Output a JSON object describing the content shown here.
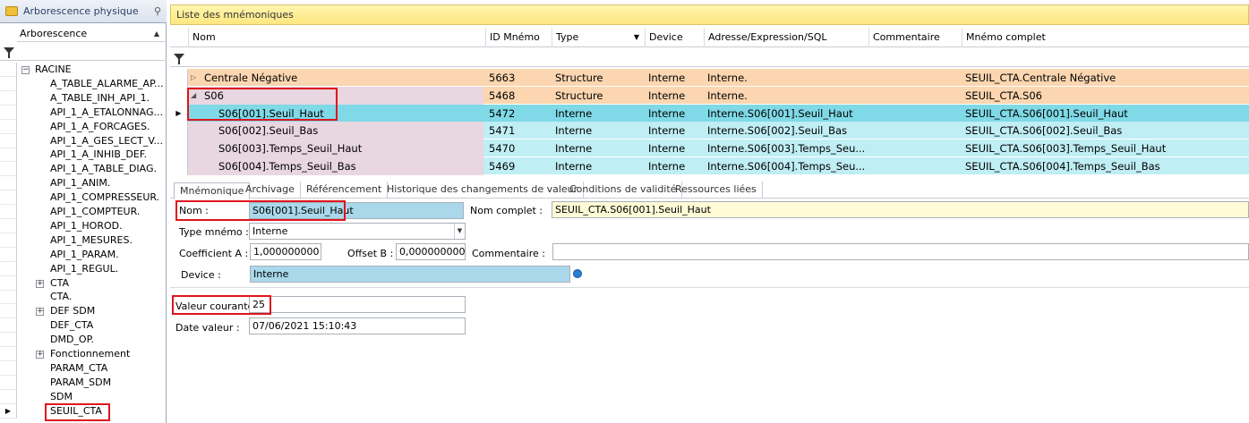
{
  "left_panel": {
    "title": "Arborescence physique",
    "column": "Arborescence",
    "tree": [
      {
        "label": "RACINE",
        "expander": "−"
      },
      {
        "label": "A_TABLE_ALARME_AP..."
      },
      {
        "label": "A_TABLE_INH_API_1."
      },
      {
        "label": "API_1_A_ETALONNAG..."
      },
      {
        "label": "API_1_A_FORCAGES."
      },
      {
        "label": "API_1_A_GES_LECT_V..."
      },
      {
        "label": "API_1_A_INHIB_DEF."
      },
      {
        "label": "API_1_A_TABLE_DIAG."
      },
      {
        "label": "API_1_ANIM."
      },
      {
        "label": "API_1_COMPRESSEUR."
      },
      {
        "label": "API_1_COMPTEUR."
      },
      {
        "label": "API_1_HOROD."
      },
      {
        "label": "API_1_MESURES."
      },
      {
        "label": "API_1_PARAM."
      },
      {
        "label": "API_1_REGUL."
      },
      {
        "label": "CTA",
        "expander": "+"
      },
      {
        "label": "CTA."
      },
      {
        "label": "DEF SDM",
        "expander": "+"
      },
      {
        "label": "DEF_CTA"
      },
      {
        "label": "DMD_OP."
      },
      {
        "label": "Fonctionnement",
        "expander": "+"
      },
      {
        "label": "PARAM_CTA"
      },
      {
        "label": "PARAM_SDM"
      },
      {
        "label": "SDM"
      },
      {
        "label": "SEUIL_CTA",
        "selected": true
      }
    ]
  },
  "grid": {
    "title": "Liste des mnémoniques",
    "columns": [
      "Nom",
      "ID Mnémo",
      "Type",
      "Device",
      "Adresse/Expression/SQL",
      "Commentaire",
      "Mnémo complet"
    ],
    "rows": [
      {
        "nom": "Centrale Négative",
        "id": "5663",
        "type": "Structure",
        "device": "Interne",
        "adresse": "Interne.",
        "commentaire": "",
        "complet": "SEUIL_CTA.Centrale Négative",
        "expander": "▷"
      },
      {
        "nom": "S06",
        "id": "5468",
        "type": "Structure",
        "device": "Interne",
        "adresse": "Interne.",
        "commentaire": "",
        "complet": "SEUIL_CTA.S06",
        "expander": "◢"
      },
      {
        "nom": "S06[001].Seuil_Haut",
        "id": "5472",
        "type": "Interne",
        "device": "Interne",
        "adresse": "Interne.S06[001].Seuil_Haut",
        "commentaire": "",
        "complet": "SEUIL_CTA.S06[001].Seuil_Haut",
        "current": true
      },
      {
        "nom": "S06[002].Seuil_Bas",
        "id": "5471",
        "type": "Interne",
        "device": "Interne",
        "adresse": "Interne.S06[002].Seuil_Bas",
        "commentaire": "",
        "complet": "SEUIL_CTA.S06[002].Seuil_Bas"
      },
      {
        "nom": "S06[003].Temps_Seuil_Haut",
        "id": "5470",
        "type": "Interne",
        "device": "Interne",
        "adresse": "Interne.S06[003].Temps_Seu...",
        "commentaire": "",
        "complet": "SEUIL_CTA.S06[003].Temps_Seuil_Haut"
      },
      {
        "nom": "S06[004].Temps_Seuil_Bas",
        "id": "5469",
        "type": "Interne",
        "device": "Interne",
        "adresse": "Interne.S06[004].Temps_Seu...",
        "commentaire": "",
        "complet": "SEUIL_CTA.S06[004].Temps_Seuil_Bas"
      }
    ]
  },
  "tabs": [
    "Mnémonique",
    "Archivage",
    "Référencement",
    "Historique des changements de valeur",
    "Conditions de validité",
    "Ressources liées"
  ],
  "form": {
    "nom_label": "Nom :",
    "nom_value": "S06[001].Seuil_Haut",
    "nom_complet_label": "Nom complet :",
    "nom_complet_value": "SEUIL_CTA.S06[001].Seuil_Haut",
    "type_label": "Type mnémo :",
    "type_value": "Interne",
    "coef_label": "Coefficient A :",
    "coef_value": "1,000000000",
    "offset_label": "Offset B :",
    "offset_value": "0,000000000",
    "commentaire_label": "Commentaire :",
    "commentaire_value": "",
    "device_label": "Device :",
    "device_value": "Interne",
    "valeur_label": "Valeur courante :",
    "valeur_value": "25",
    "date_label": "Date valeur :",
    "date_value": "07/06/2021 15:10:43"
  },
  "colors": {
    "structure_row": "#fbd6b0",
    "interne_row": "#bfeef4",
    "selected_row": "#7fd9e6",
    "highlight_box": "#e0141e"
  }
}
